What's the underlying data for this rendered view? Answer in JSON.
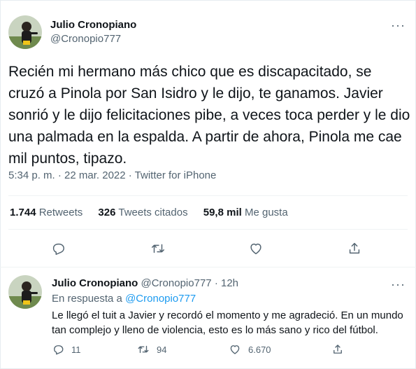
{
  "tweet": {
    "author_name": "Julio Cronopiano",
    "author_handle": "@Cronopio777",
    "text": "Recién mi hermano más chico que es discapacitado, se cruzó a Pinola por San Isidro y le dijo, te ganamos. Javier sonrió y le dijo felicitaciones pibe, a veces toca perder y le dio una palmada en la espalda. A partir de ahora, Pinola me cae mil puntos, tipazo.",
    "meta": "5:34 p. m. · 22 mar. 2022 · Twitter for iPhone",
    "stats": {
      "retweets_value": "1.744",
      "retweets_label": "Retweets",
      "quotes_value": "326",
      "quotes_label": "Tweets citados",
      "likes_value": "59,8 mil",
      "likes_label": "Me gusta"
    },
    "more_label": "···"
  },
  "reply": {
    "author_name": "Julio Cronopiano",
    "author_handle": "@Cronopio777",
    "separator": "·",
    "time": "12h",
    "reply_prefix": "En respuesta a",
    "reply_to_handle": "@Cronopio777",
    "text": "Le llegó el tuit a Javier y recordó el momento y me agradeció. En un mundo tan complejo y lleno de violencia, esto es lo más sano y rico del fútbol.",
    "counts": {
      "replies": "11",
      "retweets": "94",
      "likes": "6.670"
    },
    "more_label": "···"
  },
  "colors": {
    "text": "#0f1419",
    "secondary": "#536471",
    "link": "#1d9bf0",
    "divider": "#eff3f4"
  }
}
